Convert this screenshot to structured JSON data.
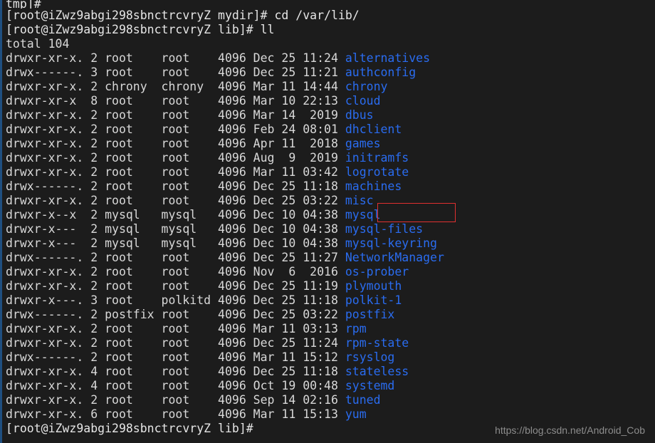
{
  "terminal": {
    "background_color": "#1c1c1c",
    "foreground_color": "#d8d8d8",
    "directory_color": "#2a6cf0",
    "border_color": "#1f4f80",
    "highlight_color": "#e03030",
    "host_prompt_mydir": "[root@iZwz9abgi298sbnctrcvryZ mydir]# ",
    "host_prompt_lib": "[root@iZwz9abgi298sbnctrcvryZ lib]# ",
    "host_prompt_lib_final": "[root@iZwz9abgi298sbnctrcvryZ lib]#",
    "command_cd": "cd /var/lib/",
    "command_ll": "ll",
    "total_line": "total 104",
    "partial_top_line": "tmp]#"
  },
  "listing": {
    "columns": [
      "permissions",
      "links",
      "owner",
      "group",
      "size",
      "month",
      "day",
      "time",
      "name"
    ],
    "rows": [
      {
        "permissions": "drwxr-xr-x.",
        "links": "2",
        "owner": "root",
        "group": "root",
        "size": "4096",
        "month": "Dec",
        "day": "25",
        "time": "11:24",
        "name": "alternatives"
      },
      {
        "permissions": "drwx------.",
        "links": "3",
        "owner": "root",
        "group": "root",
        "size": "4096",
        "month": "Dec",
        "day": "25",
        "time": "11:21",
        "name": "authconfig"
      },
      {
        "permissions": "drwxr-xr-x.",
        "links": "2",
        "owner": "chrony",
        "group": "chrony",
        "size": "4096",
        "month": "Mar",
        "day": "11",
        "time": "14:44",
        "name": "chrony"
      },
      {
        "permissions": "drwxr-xr-x",
        "links": "8",
        "owner": "root",
        "group": "root",
        "size": "4096",
        "month": "Mar",
        "day": "10",
        "time": "22:13",
        "name": "cloud"
      },
      {
        "permissions": "drwxr-xr-x.",
        "links": "2",
        "owner": "root",
        "group": "root",
        "size": "4096",
        "month": "Mar",
        "day": "14",
        "time": "2019",
        "name": "dbus"
      },
      {
        "permissions": "drwxr-xr-x.",
        "links": "2",
        "owner": "root",
        "group": "root",
        "size": "4096",
        "month": "Feb",
        "day": "24",
        "time": "08:01",
        "name": "dhclient"
      },
      {
        "permissions": "drwxr-xr-x.",
        "links": "2",
        "owner": "root",
        "group": "root",
        "size": "4096",
        "month": "Apr",
        "day": "11",
        "time": "2018",
        "name": "games"
      },
      {
        "permissions": "drwxr-xr-x.",
        "links": "2",
        "owner": "root",
        "group": "root",
        "size": "4096",
        "month": "Aug",
        "day": "9",
        "time": "2019",
        "name": "initramfs"
      },
      {
        "permissions": "drwxr-xr-x.",
        "links": "2",
        "owner": "root",
        "group": "root",
        "size": "4096",
        "month": "Mar",
        "day": "11",
        "time": "03:42",
        "name": "logrotate"
      },
      {
        "permissions": "drwx------.",
        "links": "2",
        "owner": "root",
        "group": "root",
        "size": "4096",
        "month": "Dec",
        "day": "25",
        "time": "11:18",
        "name": "machines"
      },
      {
        "permissions": "drwxr-xr-x.",
        "links": "2",
        "owner": "root",
        "group": "root",
        "size": "4096",
        "month": "Dec",
        "day": "25",
        "time": "03:22",
        "name": "misc"
      },
      {
        "permissions": "drwxr-x--x",
        "links": "2",
        "owner": "mysql",
        "group": "mysql",
        "size": "4096",
        "month": "Dec",
        "day": "10",
        "time": "04:38",
        "name": "mysql",
        "highlighted": true
      },
      {
        "permissions": "drwxr-x---",
        "links": "2",
        "owner": "mysql",
        "group": "mysql",
        "size": "4096",
        "month": "Dec",
        "day": "10",
        "time": "04:38",
        "name": "mysql-files"
      },
      {
        "permissions": "drwxr-x---",
        "links": "2",
        "owner": "mysql",
        "group": "mysql",
        "size": "4096",
        "month": "Dec",
        "day": "10",
        "time": "04:38",
        "name": "mysql-keyring"
      },
      {
        "permissions": "drwx------.",
        "links": "2",
        "owner": "root",
        "group": "root",
        "size": "4096",
        "month": "Dec",
        "day": "25",
        "time": "11:27",
        "name": "NetworkManager"
      },
      {
        "permissions": "drwxr-xr-x.",
        "links": "2",
        "owner": "root",
        "group": "root",
        "size": "4096",
        "month": "Nov",
        "day": "6",
        "time": "2016",
        "name": "os-prober"
      },
      {
        "permissions": "drwxr-xr-x.",
        "links": "2",
        "owner": "root",
        "group": "root",
        "size": "4096",
        "month": "Dec",
        "day": "25",
        "time": "11:19",
        "name": "plymouth"
      },
      {
        "permissions": "drwxr-x---.",
        "links": "3",
        "owner": "root",
        "group": "polkitd",
        "size": "4096",
        "month": "Dec",
        "day": "25",
        "time": "11:18",
        "name": "polkit-1"
      },
      {
        "permissions": "drwx------.",
        "links": "2",
        "owner": "postfix",
        "group": "root",
        "size": "4096",
        "month": "Dec",
        "day": "25",
        "time": "03:22",
        "name": "postfix"
      },
      {
        "permissions": "drwxr-xr-x.",
        "links": "2",
        "owner": "root",
        "group": "root",
        "size": "4096",
        "month": "Mar",
        "day": "11",
        "time": "03:13",
        "name": "rpm"
      },
      {
        "permissions": "drwxr-xr-x.",
        "links": "2",
        "owner": "root",
        "group": "root",
        "size": "4096",
        "month": "Dec",
        "day": "25",
        "time": "11:24",
        "name": "rpm-state"
      },
      {
        "permissions": "drwx------.",
        "links": "2",
        "owner": "root",
        "group": "root",
        "size": "4096",
        "month": "Mar",
        "day": "11",
        "time": "15:12",
        "name": "rsyslog"
      },
      {
        "permissions": "drwxr-xr-x.",
        "links": "4",
        "owner": "root",
        "group": "root",
        "size": "4096",
        "month": "Dec",
        "day": "25",
        "time": "11:18",
        "name": "stateless"
      },
      {
        "permissions": "drwxr-xr-x.",
        "links": "4",
        "owner": "root",
        "group": "root",
        "size": "4096",
        "month": "Oct",
        "day": "19",
        "time": "00:48",
        "name": "systemd"
      },
      {
        "permissions": "drwxr-xr-x.",
        "links": "2",
        "owner": "root",
        "group": "root",
        "size": "4096",
        "month": "Sep",
        "day": "14",
        "time": "02:16",
        "name": "tuned"
      },
      {
        "permissions": "drwxr-xr-x.",
        "links": "6",
        "owner": "root",
        "group": "root",
        "size": "4096",
        "month": "Mar",
        "day": "11",
        "time": "15:13",
        "name": "yum"
      }
    ]
  },
  "watermark": {
    "text": "https://blog.csdn.net/Android_Cob"
  }
}
